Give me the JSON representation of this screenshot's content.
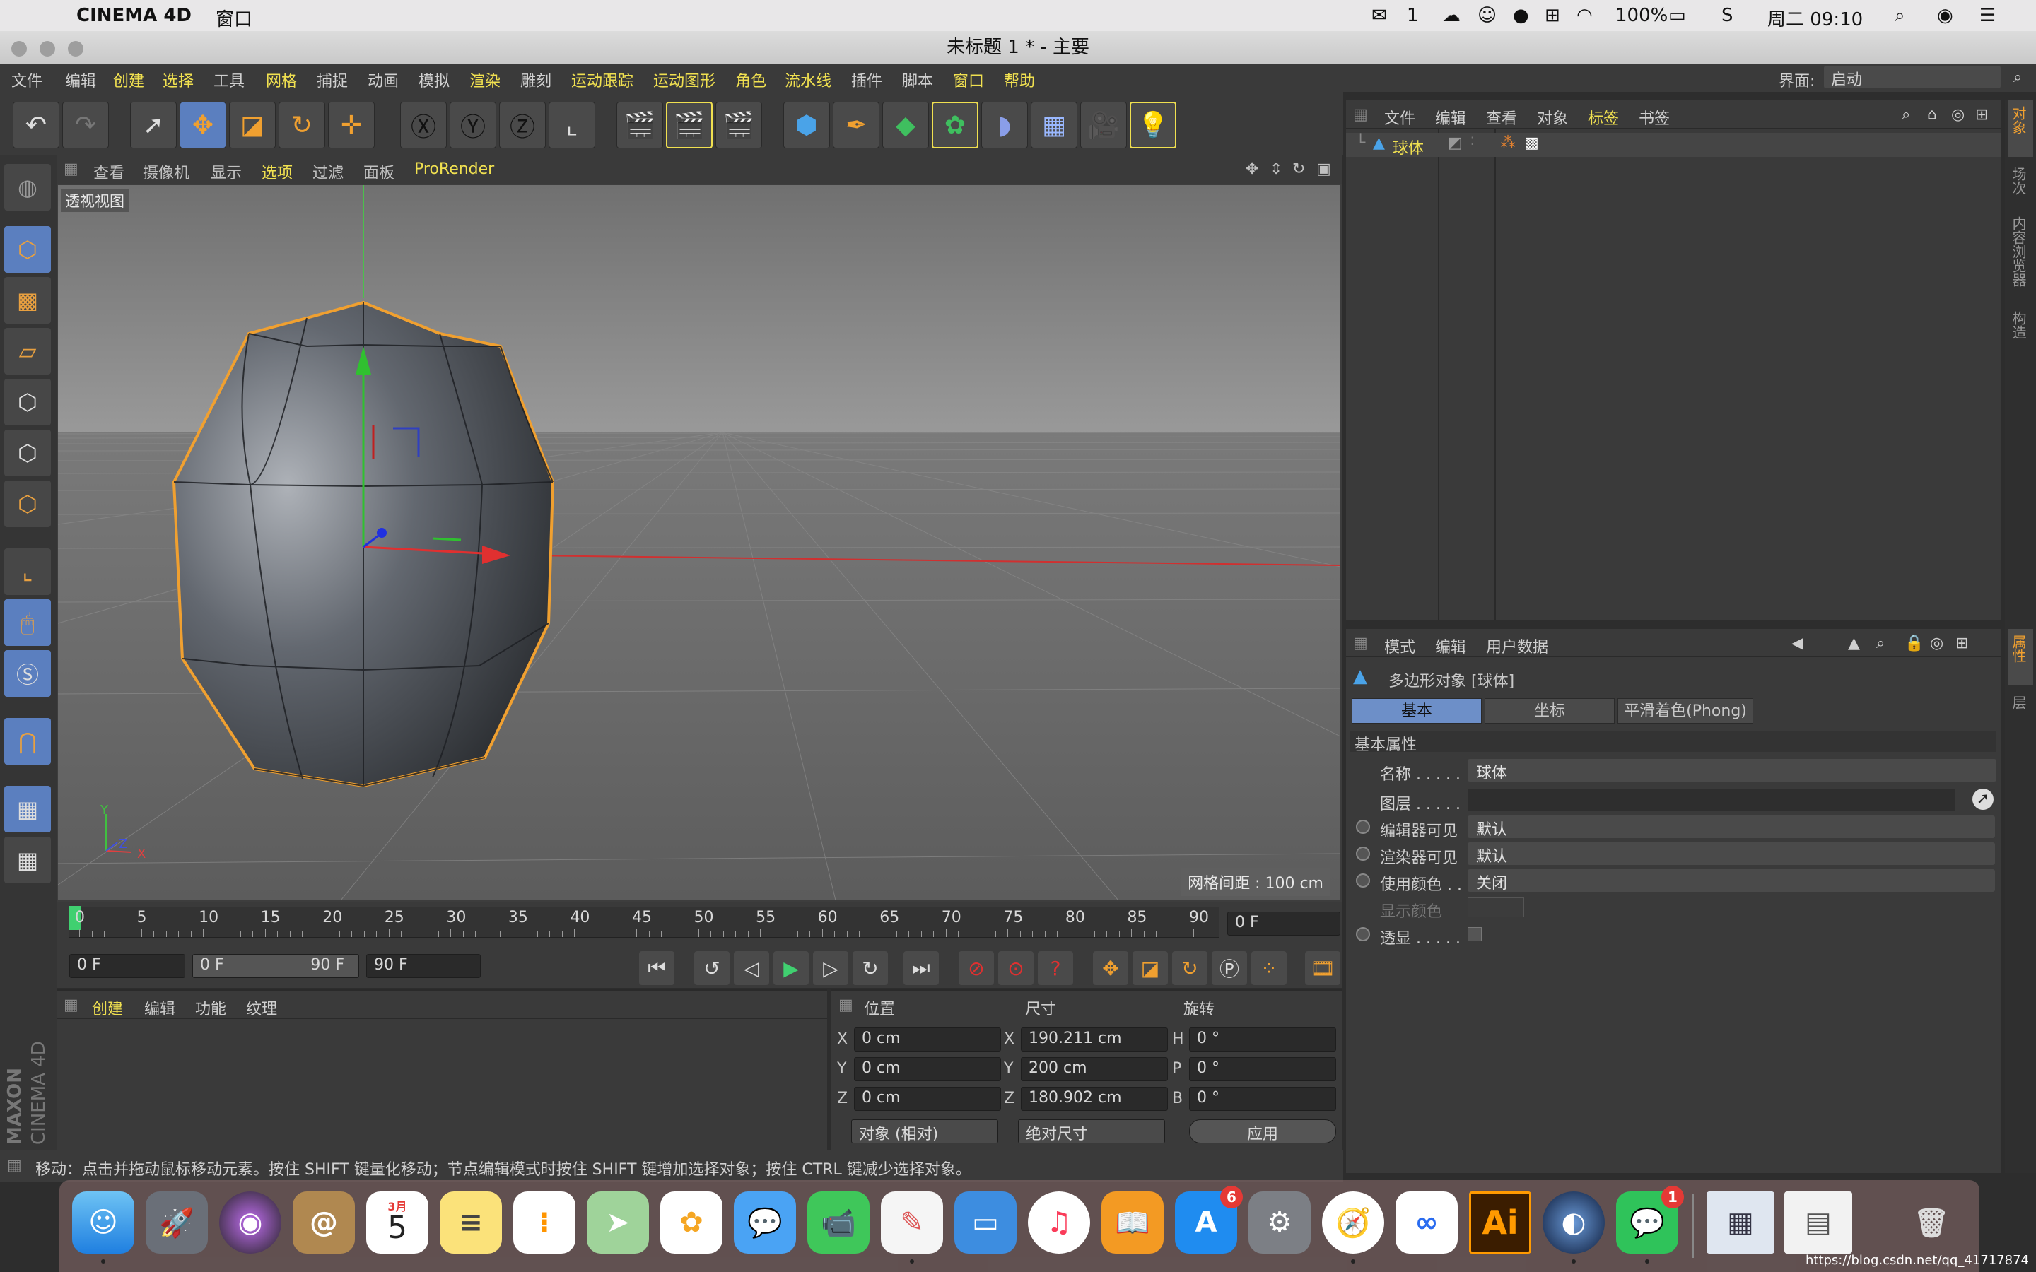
{
  "macos": {
    "app_name": "CINEMA 4D",
    "menu_window": "窗口",
    "wechat_count": "1",
    "battery": "100%",
    "clock": "周二 09:10"
  },
  "window": {
    "title": "未标题 1 * - 主要"
  },
  "menu": {
    "items": [
      "文件",
      "编辑",
      "创建",
      "选择",
      "工具",
      "网格",
      "捕捉",
      "动画",
      "模拟",
      "渲染",
      "雕刻",
      "运动跟踪",
      "运动图形",
      "角色",
      "流水线",
      "插件",
      "脚本",
      "窗口",
      "帮助"
    ],
    "layout_label": "界面:",
    "layout_value": "启动"
  },
  "viewport": {
    "menu": [
      "查看",
      "摄像机",
      "显示",
      "选项",
      "过滤",
      "面板",
      "ProRender"
    ],
    "label": "透视视图",
    "grid_info": "网格间距 : 100 cm",
    "axis_y": "Y",
    "axis_z": "Z",
    "axis_x": "X"
  },
  "timeline": {
    "ticks": [
      "0",
      "5",
      "10",
      "15",
      "20",
      "25",
      "30",
      "35",
      "40",
      "45",
      "50",
      "55",
      "60",
      "65",
      "70",
      "75",
      "80",
      "85",
      "90"
    ],
    "current_frame": "0 F"
  },
  "transport": {
    "start": "0 F",
    "range_start": "0 F",
    "range_end": "90 F",
    "end": "90 F"
  },
  "material": {
    "menu": [
      "创建",
      "编辑",
      "功能",
      "纹理"
    ]
  },
  "coords": {
    "headers": [
      "位置",
      "尺寸",
      "旋转"
    ],
    "rows": [
      {
        "axis": "X",
        "pos": "0 cm",
        "size_axis": "X",
        "size": "190.211 cm",
        "rot_axis": "H",
        "rot": "0 °"
      },
      {
        "axis": "Y",
        "pos": "0 cm",
        "size_axis": "Y",
        "size": "200 cm",
        "rot_axis": "P",
        "rot": "0 °"
      },
      {
        "axis": "Z",
        "pos": "0 cm",
        "size_axis": "Z",
        "size": "180.902 cm",
        "rot_axis": "B",
        "rot": "0 °"
      }
    ],
    "mode": "对象 (相对)",
    "size_mode": "绝对尺寸",
    "apply": "应用"
  },
  "status": {
    "text": "移动：点击并拖动鼠标移动元素。按住 SHIFT 键量化移动；节点编辑模式时按住 SHIFT 键增加选择对象；按住 CTRL 键减少选择对象。"
  },
  "objects": {
    "menu": [
      "文件",
      "编辑",
      "查看",
      "对象",
      "标签",
      "书签"
    ],
    "item": "球体"
  },
  "attributes": {
    "menu": [
      "模式",
      "编辑",
      "用户数据"
    ],
    "object_title": "多边形对象 [球体]",
    "tabs": [
      "基本",
      "坐标",
      "平滑着色(Phong)"
    ],
    "section": "基本属性",
    "name_label": "名称 . . . . .",
    "name_value": "球体",
    "layer_label": "图层 . . . . .",
    "editor_visible_label": "编辑器可见",
    "editor_visible_value": "默认",
    "render_visible_label": "渲染器可见",
    "render_visible_value": "默认",
    "use_color_label": "使用颜色 . .",
    "use_color_value": "关闭",
    "display_color_label": "显示颜色",
    "xray_label": "透显 . . . . ."
  },
  "side_tabs": [
    "对象",
    "场次",
    "内容浏览器",
    "构造",
    "属性",
    "层"
  ],
  "left_logo": {
    "brand": "MAXON",
    "product": "CINEMA 4D"
  },
  "dock": {
    "ai_label": "Ai",
    "calendar_month": "3月",
    "calendar_day": "5",
    "appstore_badge": "6",
    "wechat_badge": "1"
  },
  "watermark": "https://blog.csdn.net/qq_41717874",
  "colors": {
    "accent_yellow": "#f0e050",
    "selection_orange": "#f0a030",
    "x_axis": "#e03030",
    "y_axis": "#30c030",
    "z_axis": "#3040e0"
  }
}
